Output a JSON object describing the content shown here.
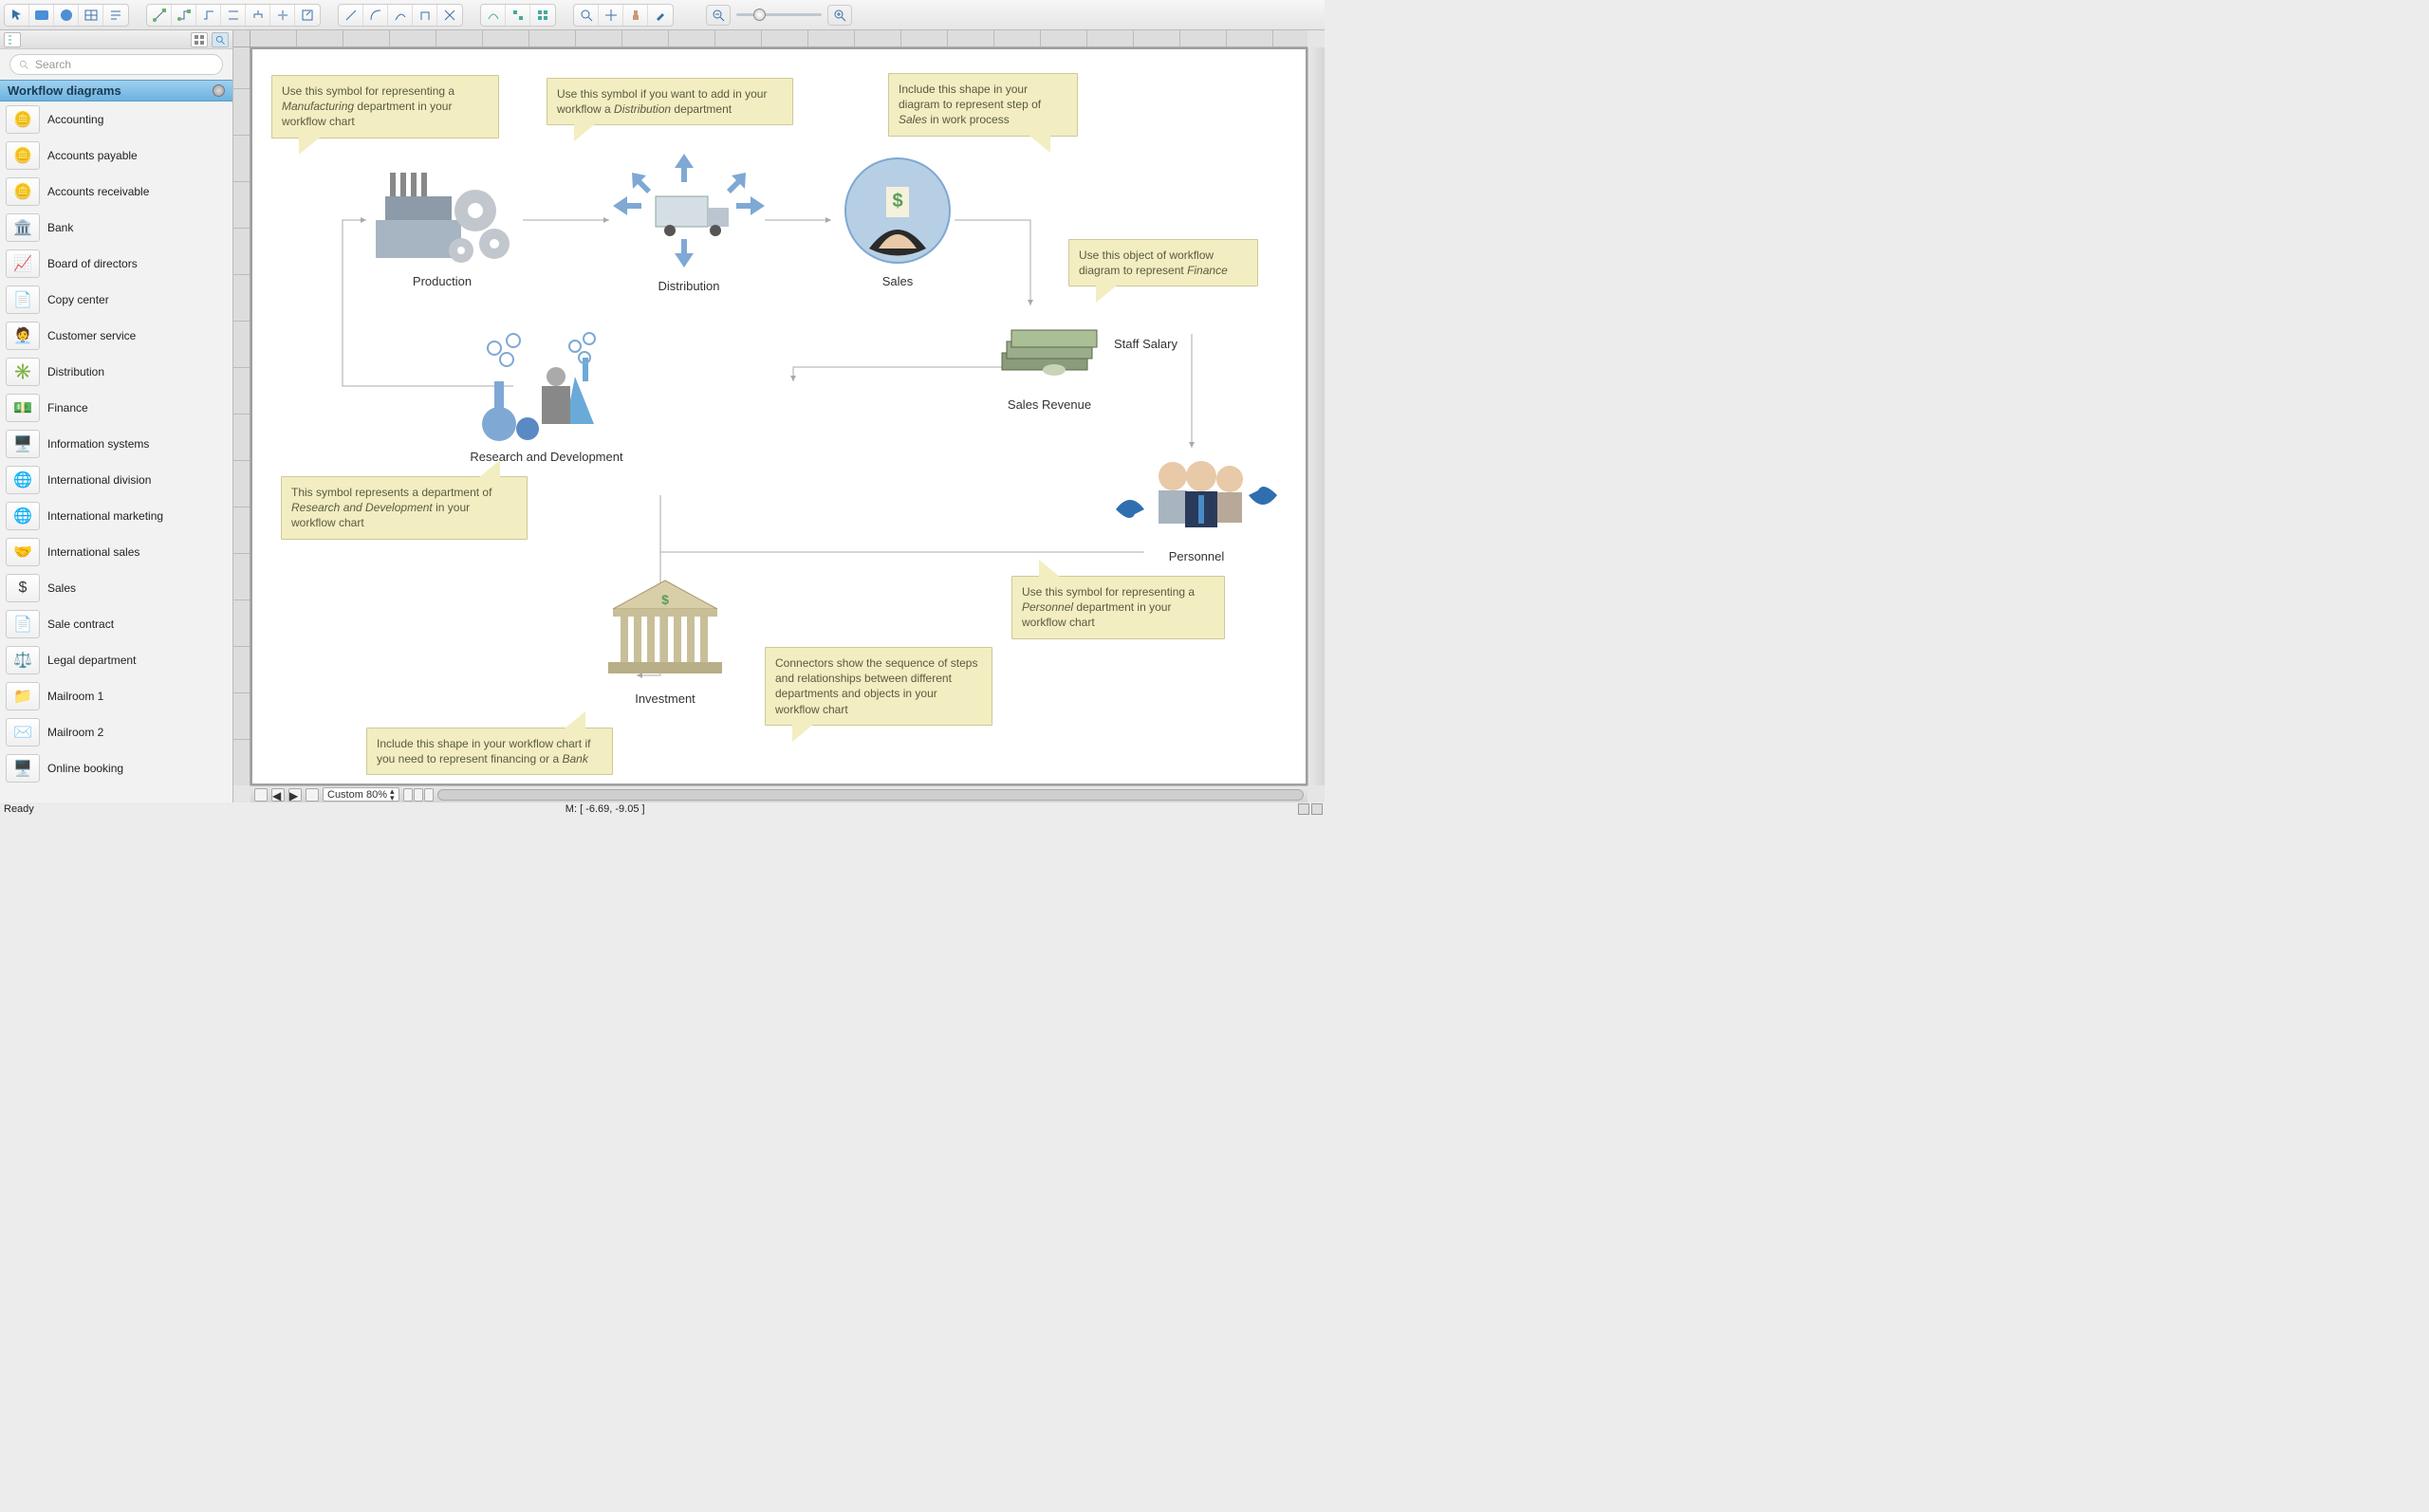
{
  "toolbar": {
    "groups": [
      [
        "pointer",
        "rect",
        "ellipse",
        "table",
        "text"
      ],
      [
        "connector-l",
        "connector-step",
        "connector-curve",
        "connector-smart",
        "connector-tree",
        "connector-branch",
        "connector-export"
      ],
      [
        "conn-line",
        "conn-arc",
        "conn-multi",
        "conn-up",
        "conn-cross"
      ],
      [
        "route-auto",
        "route-align",
        "route-grid"
      ],
      [
        "zoom-tool",
        "pan-tool",
        "stamp-tool",
        "eyedrop-tool"
      ]
    ],
    "zoom_out": "−",
    "zoom_in": "+"
  },
  "panel": {
    "search_placeholder": "Search",
    "section_title": "Workflow diagrams",
    "items": [
      {
        "label": "Accounting",
        "icon": "🪙"
      },
      {
        "label": "Accounts payable",
        "icon": "🪙"
      },
      {
        "label": "Accounts receivable",
        "icon": "🪙"
      },
      {
        "label": "Bank",
        "icon": "🏛️"
      },
      {
        "label": "Board of directors",
        "icon": "📈"
      },
      {
        "label": "Copy center",
        "icon": "📄"
      },
      {
        "label": "Customer service",
        "icon": "🧑‍💼"
      },
      {
        "label": "Distribution",
        "icon": "✳️"
      },
      {
        "label": "Finance",
        "icon": "💵"
      },
      {
        "label": "Information systems",
        "icon": "🖥️"
      },
      {
        "label": "International division",
        "icon": "🌐"
      },
      {
        "label": "International marketing",
        "icon": "🌐"
      },
      {
        "label": "International sales",
        "icon": "🤝"
      },
      {
        "label": "Sales",
        "icon": "$"
      },
      {
        "label": "Sale contract",
        "icon": "📄"
      },
      {
        "label": "Legal department",
        "icon": "⚖️"
      },
      {
        "label": "Mailroom 1",
        "icon": "📁"
      },
      {
        "label": "Mailroom 2",
        "icon": "✉️"
      },
      {
        "label": "Online booking",
        "icon": "🖥️"
      }
    ]
  },
  "canvas": {
    "nodes": {
      "production": "Production",
      "distribution": "Distribution",
      "sales": "Sales",
      "salesrevenue": "Sales Revenue",
      "staffsalary": "Staff Salary",
      "personnel": "Personnel",
      "rnd": "Research and Development",
      "investment": "Investment"
    },
    "callouts": {
      "c1a": "Use this symbol for representing a ",
      "c1b": "Manufacturing",
      "c1c": " department in your workflow chart",
      "c2a": "Use this symbol if you want to add in your workflow a ",
      "c2b": "Distribution",
      "c2c": " department",
      "c3a": "Include this shape in your diagram to represent step of ",
      "c3b": "Sales",
      "c3c": " in work process",
      "c4a": "Use this object of workflow diagram to represent ",
      "c4b": "Finance",
      "c5a": "This symbol represents a department of ",
      "c5b": "Research and Development",
      "c5c": " in your workflow chart",
      "c6a": "Use this symbol for representing a ",
      "c6b": "Personnel",
      "c6c": " department in your workflow chart",
      "c7": "Connectors show the sequence of steps and relationships between different departments and objects in your workflow chart",
      "c8a": "Include this shape in your workflow chart if you need to represent financing or a ",
      "c8b": "Bank"
    }
  },
  "footer": {
    "zoom_label": "Custom 80%",
    "status": "Ready",
    "mouse": "M: [ -6.69, -9.05 ]"
  }
}
